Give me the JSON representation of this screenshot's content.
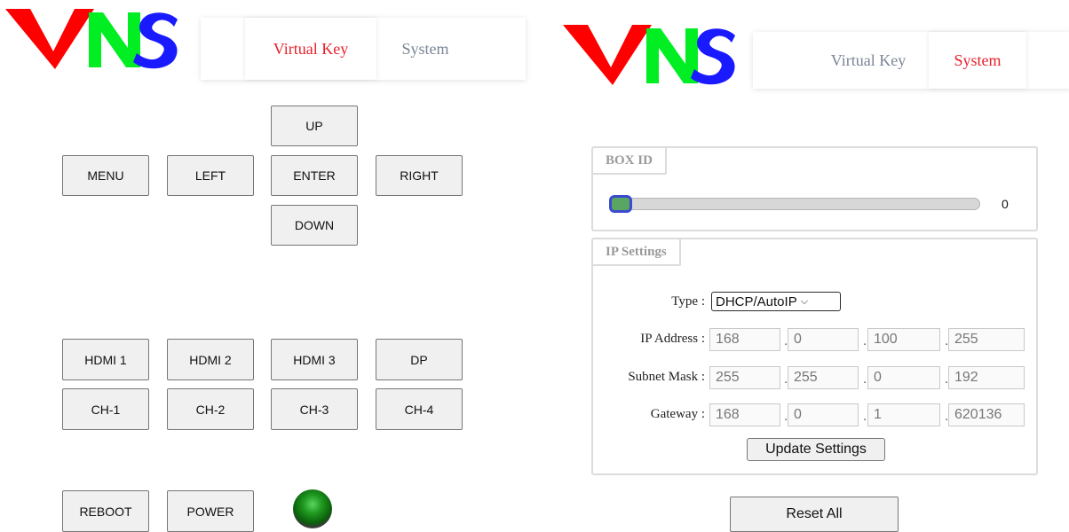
{
  "brand": {
    "logo_text": "VNS",
    "colors": {
      "v": "#ff0000",
      "n": "#00ee22",
      "s": "#1a1aff"
    }
  },
  "left_panel": {
    "tabs": [
      {
        "label": "Virtual Key",
        "active": true
      },
      {
        "label": "System",
        "active": false
      }
    ],
    "nav_keys": {
      "up": "UP",
      "menu": "MENU",
      "left": "LEFT",
      "enter": "ENTER",
      "right": "RIGHT",
      "down": "DOWN"
    },
    "inputs": [
      "HDMI 1",
      "HDMI 2",
      "HDMI 3",
      "DP"
    ],
    "channels": [
      "CH-1",
      "CH-2",
      "CH-3",
      "CH-4"
    ],
    "power_keys": {
      "reboot": "REBOOT",
      "power": "POWER"
    },
    "status_led": {
      "state": "on",
      "color": "#1f9a1f"
    }
  },
  "right_panel": {
    "tabs": [
      {
        "label": "Virtual Key",
        "active": false
      },
      {
        "label": "System",
        "active": true
      }
    ],
    "box_id": {
      "legend": "BOX ID",
      "value": "0",
      "slider_fraction": 0
    },
    "ip_settings": {
      "legend": "IP Settings",
      "type_label": "Type :",
      "type_value": "DHCP/AutoIP",
      "ip_address_label": "IP Address :",
      "ip_address": [
        "168",
        "0",
        "100",
        "255"
      ],
      "subnet_mask_label": "Subnet Mask :",
      "subnet_mask": [
        "255",
        "255",
        "0",
        "192"
      ],
      "gateway_label": "Gateway :",
      "gateway": [
        "168",
        "0",
        "1",
        "620136"
      ],
      "update_button": "Update Settings"
    },
    "reset_button": "Reset All"
  }
}
